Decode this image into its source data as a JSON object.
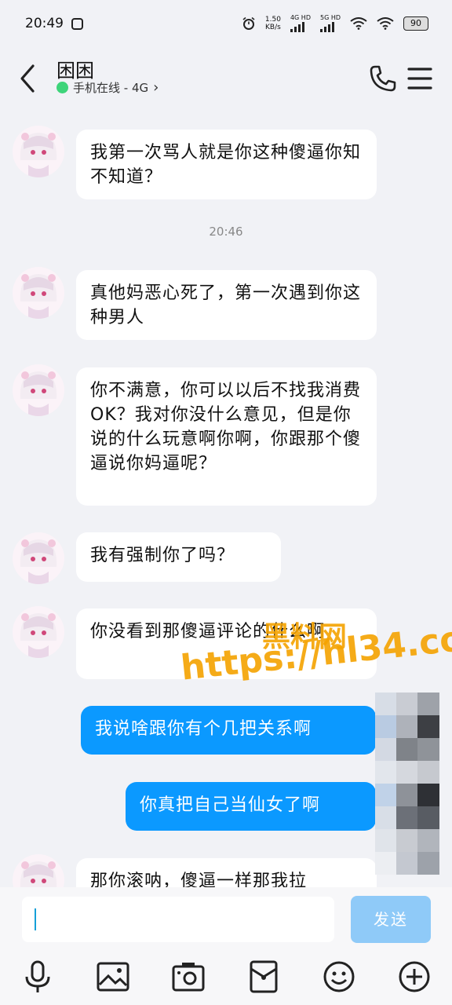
{
  "status_bar": {
    "time": "20:49",
    "speed_value": "1.50",
    "speed_unit": "KB/s",
    "net1": "4G HD",
    "net2": "5G HD",
    "battery": "90"
  },
  "header": {
    "contact_name": "困困",
    "status_text": "手机在线 - 4G",
    "chevron": "›"
  },
  "messages": [
    {
      "side": "in",
      "text": "我第一次骂人就是你这种傻逼你知不知道？"
    },
    {
      "timestamp": "20:46"
    },
    {
      "side": "in",
      "text": "真他妈恶心死了，第一次遇到你这种男人"
    },
    {
      "side": "in",
      "text": "你不满意，你可以以后不找我消费OK？我对你没什么意见，但是你说的什么玩意啊你啊，你跟那个傻逼说你妈逼呢？"
    },
    {
      "side": "in",
      "text": "我有强制你了吗？"
    },
    {
      "side": "in",
      "text": "你没看到那傻逼评论的什么啊"
    },
    {
      "side": "out",
      "text": "我说啥跟你有个几把关系啊"
    },
    {
      "side": "out",
      "text": "你真把自己当仙女了啊"
    },
    {
      "side": "in",
      "text": "那你滚呐，傻逼一样那我拉"
    }
  ],
  "watermark": {
    "line1": "黑料网",
    "line2": "https://hl34.co"
  },
  "input": {
    "value": "",
    "send_label": "发送"
  },
  "toolbar_icons": [
    "microphone-icon",
    "image-icon",
    "camera-icon",
    "red-packet-icon",
    "emoji-icon",
    "plus-icon"
  ],
  "colors": {
    "background": "#f1f2f6",
    "out_bubble": "#0b99ff",
    "in_bubble": "#ffffff",
    "send_button": "#8fcaf8",
    "online": "#3ed47a",
    "watermark": "#f5a300"
  }
}
